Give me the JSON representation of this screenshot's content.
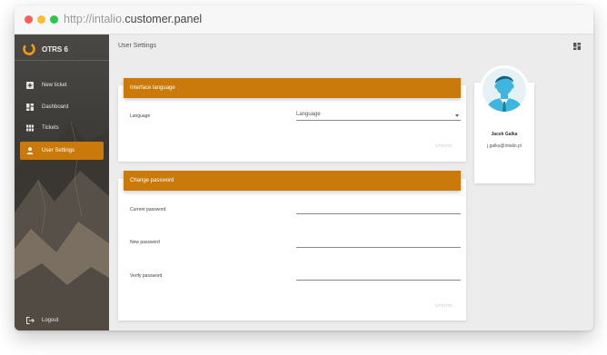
{
  "browser": {
    "url_prefix": "http://intalio.",
    "url_strong": "customer.panel"
  },
  "sidebar": {
    "brand": "OTRS 6",
    "items": [
      {
        "label": "New ticket",
        "icon": "plus-square-icon"
      },
      {
        "label": "Dashboard",
        "icon": "dashboard-icon"
      },
      {
        "label": "Tickets",
        "icon": "grid-icon"
      },
      {
        "label": "User Settings",
        "icon": "person-icon",
        "active": true
      }
    ],
    "logout": {
      "label": "Logout",
      "icon": "logout-icon"
    }
  },
  "header": {
    "title": "User Settings"
  },
  "language_card": {
    "title": "Interface language",
    "field_label": "Language",
    "select_value": "Language",
    "update_label": "UPDATE"
  },
  "password_card": {
    "title": "Change password",
    "current_label": "Current password",
    "new_label": "New password",
    "verify_label": "Verify password",
    "current_value": "",
    "new_value": "",
    "verify_value": "",
    "update_label": "UPDATE"
  },
  "profile": {
    "name": "Jacek Galka",
    "email": "j.galka@intalio.pl"
  },
  "colors": {
    "accent": "#c97a0a",
    "window_bg": "#ececec",
    "avatar_blue": "#3fb6dd"
  }
}
